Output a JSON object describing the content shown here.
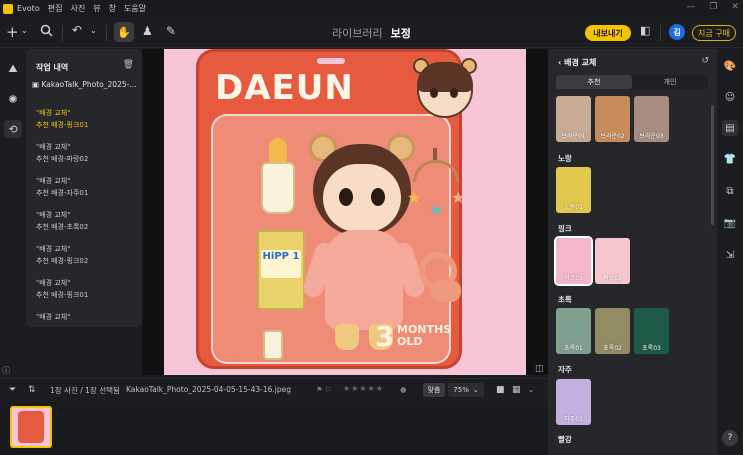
{
  "menubar": {
    "app_name": "Evoto",
    "items": [
      "편집",
      "사진",
      "뷰",
      "창",
      "도움말"
    ]
  },
  "toolbar": {
    "tabs": [
      {
        "label": "라이브러리",
        "active": false
      },
      {
        "label": "보정",
        "active": true
      }
    ],
    "export_label": "내보내기",
    "avatar_initial": "김",
    "buy_label": "지금 구매"
  },
  "history": {
    "title": "작업 내역",
    "file_name": "KakaoTalk_Photo_2025-...",
    "items": [
      {
        "line1": "\"배경 교체\"",
        "line2": "추천 배경-핑크01",
        "active": true
      },
      {
        "line1": "\"배경 교체\"",
        "line2": "추천 배경-파랑02",
        "active": false
      },
      {
        "line1": "\"배경 교체\"",
        "line2": "추천 배경-자주01",
        "active": false
      },
      {
        "line1": "\"배경 교체\"",
        "line2": "추천 배경-초록02",
        "active": false
      },
      {
        "line1": "\"배경 교체\"",
        "line2": "추천 배경-핑크02",
        "active": false
      },
      {
        "line1": "\"배경 교체\"",
        "line2": "추천 배경-핑크01",
        "active": false
      },
      {
        "line1": "\"배경 교체\"",
        "line2": "",
        "active": false
      }
    ]
  },
  "photo": {
    "brand": "DAEUN",
    "badge_number": "3",
    "badge_text": "MONTHS OLD",
    "can_label": "HiPP 1"
  },
  "bottombar": {
    "selection": "1장 사진 / 1장 선택됨",
    "file_name": "KakaoTalk_Photo_2025-04-05-15-43-16.jpeg",
    "stars": "★★★★★",
    "fit_label": "맞춤",
    "zoom": "75%"
  },
  "rpanel": {
    "title": "배경 교체",
    "seg": [
      {
        "label": "추천",
        "active": true
      },
      {
        "label": "개인",
        "active": false
      }
    ],
    "sections": [
      {
        "label": "",
        "swatches": [
          {
            "label": "브라운01",
            "color": "#c9ab94"
          },
          {
            "label": "브라운02",
            "color": "#c88c5c"
          },
          {
            "label": "브라운03",
            "color": "#a88d80"
          }
        ]
      },
      {
        "label": "노랑",
        "swatches": [
          {
            "label": "노랑01",
            "color": "#e2c84c"
          }
        ]
      },
      {
        "label": "핑크",
        "swatches": [
          {
            "label": "핑크01",
            "color": "#f4b6c8",
            "selected": true
          },
          {
            "label": "핑크02",
            "color": "#f6c7cf"
          }
        ]
      },
      {
        "label": "초록",
        "swatches": [
          {
            "label": "초록01",
            "color": "#7fa08e"
          },
          {
            "label": "초록02",
            "color": "#918c63"
          },
          {
            "label": "초록03",
            "color": "#1e5a48"
          }
        ]
      },
      {
        "label": "자주",
        "swatches": [
          {
            "label": "자주01",
            "color": "#c4b0e0"
          }
        ]
      },
      {
        "label": "빨강",
        "swatches": []
      }
    ]
  }
}
